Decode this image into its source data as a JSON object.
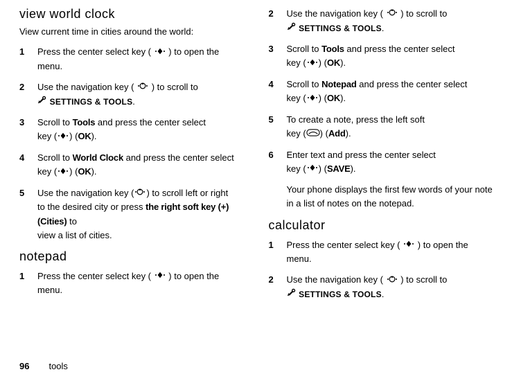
{
  "left": {
    "section1_title": "view world clock",
    "section1_intro": "View current time in cities around the world:",
    "steps1": [
      {
        "num": "1",
        "prefix": "Press the center select key (",
        "mid": ") to open the",
        "tail": "menu.",
        "icon": "center"
      },
      {
        "num": "2",
        "prefix": "Use the navigation key (",
        "mid": ") to scroll to",
        "tail_icon": "wrench",
        "tail_menu": "SETTINGS & TOOLS",
        "tail_suffix": ".",
        "icon": "nav"
      },
      {
        "num": "3",
        "text_a": "Scroll to ",
        "bold_a": "Tools",
        "text_b": " and press the center select",
        "line2_a": "key (",
        "line2_b": ") (",
        "bold_b": "OK",
        "line2_c": ").",
        "icon": "center"
      },
      {
        "num": "4",
        "text_a": "Scroll to ",
        "bold_a": "World Clock",
        "text_b": " and press the center select",
        "line2_a": "key (",
        "line2_b": ") (",
        "bold_b": "OK",
        "line2_c": ").",
        "icon": "center"
      },
      {
        "num": "5",
        "prefix": "Use the navigation key (",
        "mid": ") to scroll left or right",
        "line2": "to the desired city or press ",
        "bold_a": "the right soft key (+) (Cities)",
        "line2_end": " to",
        "line3": "view a list of cities.",
        "icon": "nav"
      }
    ],
    "section2_title": "notepad",
    "steps2": [
      {
        "num": "1",
        "prefix": "Press the center select key (",
        "mid": ") to open the",
        "tail": "menu.",
        "icon": "center"
      }
    ]
  },
  "right": {
    "steps1": [
      {
        "num": "2",
        "prefix": "Use the navigation key (",
        "mid": ") to scroll to",
        "tail_icon": "wrench",
        "tail_menu": "SETTINGS & TOOLS",
        "tail_suffix": ".",
        "icon": "nav"
      },
      {
        "num": "3",
        "text_a": "Scroll to ",
        "bold_a": "Tools",
        "text_b": " and press the center select",
        "line2_a": "key (",
        "line2_b": ") (",
        "bold_b": "OK",
        "line2_c": ").",
        "icon": "center"
      },
      {
        "num": "4",
        "text_a": "Scroll to ",
        "bold_a": "Notepad",
        "text_b": " and press the center select",
        "line2_a": "key (",
        "line2_b": ") (",
        "bold_b": "OK",
        "line2_c": ").",
        "icon": "center"
      },
      {
        "num": "5",
        "text_a": "To create a note, press the left soft",
        "line2_a": "key (",
        "line2_b": ") (",
        "bold_b": "Add",
        "line2_c": ").",
        "icon": "softkey"
      },
      {
        "num": "6",
        "text_a": "Enter text and press the center select",
        "line2_a": "key (",
        "line2_b": ") (",
        "bold_b": "SAVE",
        "line2_c": ").",
        "icon": "center",
        "result": "Your phone displays the first few words of your note in a list of notes on the notepad."
      }
    ],
    "section2_title": "calculator",
    "steps2": [
      {
        "num": "1",
        "prefix": "Press the center select key (",
        "mid": ") to open the",
        "tail": "menu.",
        "icon": "center"
      },
      {
        "num": "2",
        "prefix": "Use the navigation key (",
        "mid": ") to scroll to",
        "tail_icon": "wrench",
        "tail_menu": "SETTINGS & TOOLS",
        "tail_suffix": ".",
        "icon": "nav"
      }
    ]
  },
  "footer": {
    "page": "96",
    "section": "tools"
  }
}
